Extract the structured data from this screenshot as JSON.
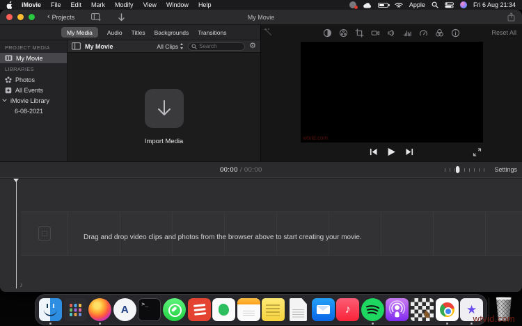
{
  "menu_bar": {
    "app_name": "iMovie",
    "items": [
      "File",
      "Edit",
      "Mark",
      "Modify",
      "View",
      "Window",
      "Help"
    ],
    "status_text": "Apple",
    "clock": "Fri 6 Aug 21:34",
    "status_icons": [
      "menubar-app-icon",
      "cloud-icon",
      "battery-icon",
      "wifi-icon",
      "spotlight-icon",
      "control-center-icon",
      "siri-icon"
    ]
  },
  "title_bar": {
    "back_label": "Projects",
    "title": "My Movie",
    "icons": [
      "media-organizer-icon",
      "import-arrow-icon",
      "share-icon"
    ]
  },
  "tabs": {
    "items": [
      "My Media",
      "Audio",
      "Titles",
      "Backgrounds",
      "Transitions"
    ],
    "selected": "My Media"
  },
  "sidebar": {
    "section1": "PROJECT MEDIA",
    "project_item": "My Movie",
    "section2": "LIBRARIES",
    "photos": "Photos",
    "all_events": "All Events",
    "imovie_library": "iMovie Library",
    "library_date": "6-08-2021"
  },
  "browser": {
    "title": "My Movie",
    "filter_label": "All Clips",
    "search_placeholder": "Search",
    "import_label": "Import Media"
  },
  "viewer": {
    "reset_label": "Reset All",
    "tools": [
      "enhance-wand-icon",
      "color-balance-icon",
      "color-correction-icon",
      "crop-icon",
      "stabilization-icon",
      "volume-icon",
      "noise-reduction-icon",
      "speed-icon",
      "clip-filter-icon",
      "info-icon"
    ],
    "transport": [
      "skip-back-icon",
      "play-icon",
      "skip-forward-icon",
      "fullscreen-icon"
    ]
  },
  "timeline_bar": {
    "current_time": "00:00",
    "separator": "/",
    "total_time": "00:00",
    "settings_label": "Settings"
  },
  "timeline": {
    "empty_message": "Drag and drop video clips and photos from the browser above to start creating your movie."
  },
  "dock": {
    "apps": [
      "finder",
      "launchpad",
      "firefox",
      "app-store",
      "terminal",
      "whatsapp",
      "todoist",
      "evernote",
      "calendar",
      "stickies",
      "textedit",
      "mail",
      "music",
      "spotify",
      "podcasts",
      "chess",
      "chrome",
      "star-app",
      "trash"
    ]
  },
  "preview_watermark": "wtvid.com",
  "watermark": "wtvid.com",
  "colors": {
    "traffic_red": "#ff5f57",
    "traffic_yellow": "#febc2e",
    "traffic_green": "#28c840",
    "selection_gray": "#515154",
    "timeline_bg": "#2e2e30"
  }
}
